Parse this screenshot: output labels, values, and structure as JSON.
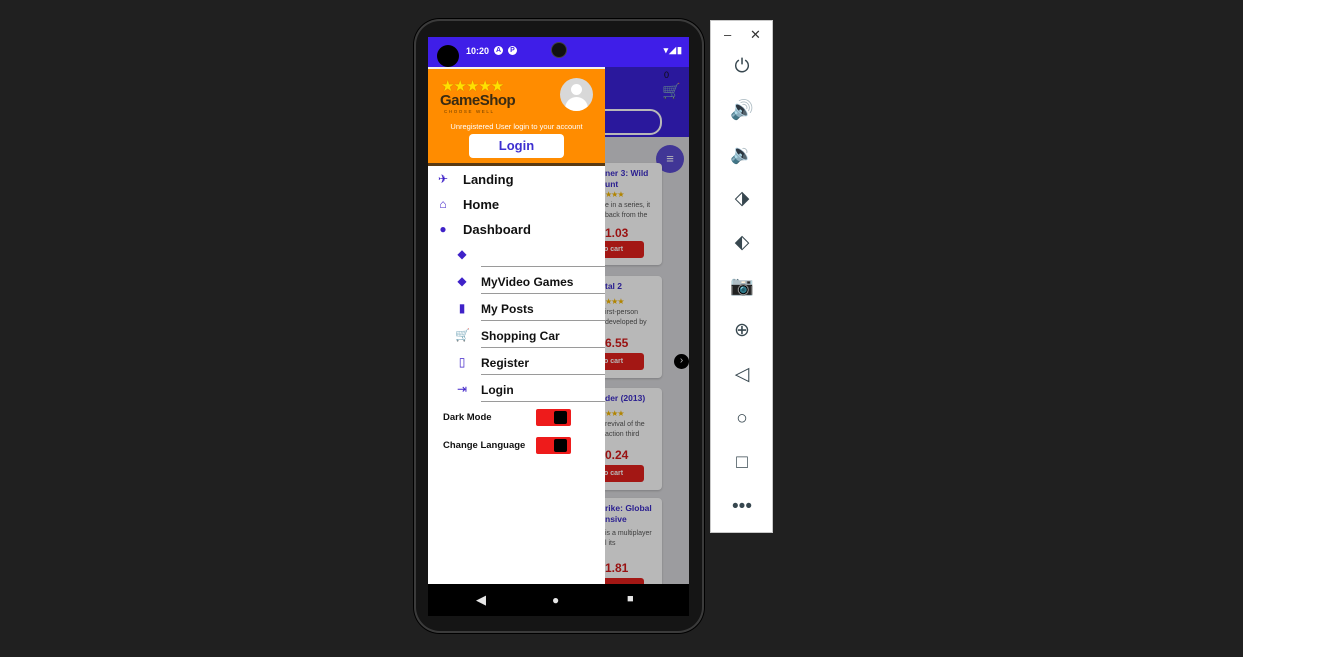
{
  "status_bar": {
    "time": "10:20",
    "indicators": [
      "A",
      "P"
    ],
    "right_icons": "wifi-signal-battery"
  },
  "background_page": {
    "cart_count": "0",
    "cards": [
      {
        "title": "ner 3: Wild ...unt",
        "title_line1": "ner 3: Wild",
        "title_line2": "unt",
        "desc_line1": "e in a series, it",
        "desc_line2": "back from the",
        "price": "1.03",
        "button": "o cart"
      },
      {
        "title": "tal 2",
        "title_line1": "tal 2",
        "title_line2": "",
        "desc_line1": "irst-person",
        "desc_line2": "developed by",
        "price": "6.55",
        "button": "o cart"
      },
      {
        "title": "der (2013)",
        "title_line1": "der (2013)",
        "title_line2": "",
        "desc_line1": "revival of the",
        "desc_line2": "action third",
        "price": "0.24",
        "button": "o cart"
      },
      {
        "title": "rike: Global ...nsive",
        "title_line1": "rike: Global",
        "title_line2": "nsive",
        "desc_line1": "is a multiplayer",
        "desc_line2": "l its",
        "price": "1.81",
        "button": ""
      }
    ]
  },
  "drawer": {
    "logo_name": "GameShop",
    "logo_tagline": "CHOOSE WELL",
    "unregistered_text": "Unregistered User login to your account",
    "login_button": "Login",
    "nav": [
      {
        "label": "Landing",
        "icon": "airplane-icon"
      },
      {
        "label": "Home",
        "icon": "home-icon"
      },
      {
        "label": "Dashboard",
        "icon": "person-icon"
      }
    ],
    "subnav": [
      {
        "label": "",
        "icon": "tag-icon"
      },
      {
        "label": "MyVideo Games",
        "icon": "tag-icon"
      },
      {
        "label": "My Posts",
        "icon": "clipboard-icon"
      },
      {
        "label": "Shopping Car",
        "icon": "cart-icon"
      },
      {
        "label": "Register",
        "icon": "clipboard-outline-icon"
      },
      {
        "label": "Login",
        "icon": "login-icon"
      }
    ],
    "toggles": [
      {
        "label": "Dark Mode",
        "state": "on"
      },
      {
        "label": "Change Language",
        "state": "on"
      }
    ]
  },
  "emulator_toolbar": {
    "buttons": [
      "power",
      "volume-up",
      "volume-down",
      "rotate-left",
      "rotate-right",
      "screenshot",
      "zoom",
      "back",
      "home",
      "overview",
      "more"
    ]
  },
  "colors": {
    "accent": "#3f1ee8",
    "header": "#ff8c00",
    "toggle": "#ee1b1b",
    "price": "#d51a1a"
  }
}
